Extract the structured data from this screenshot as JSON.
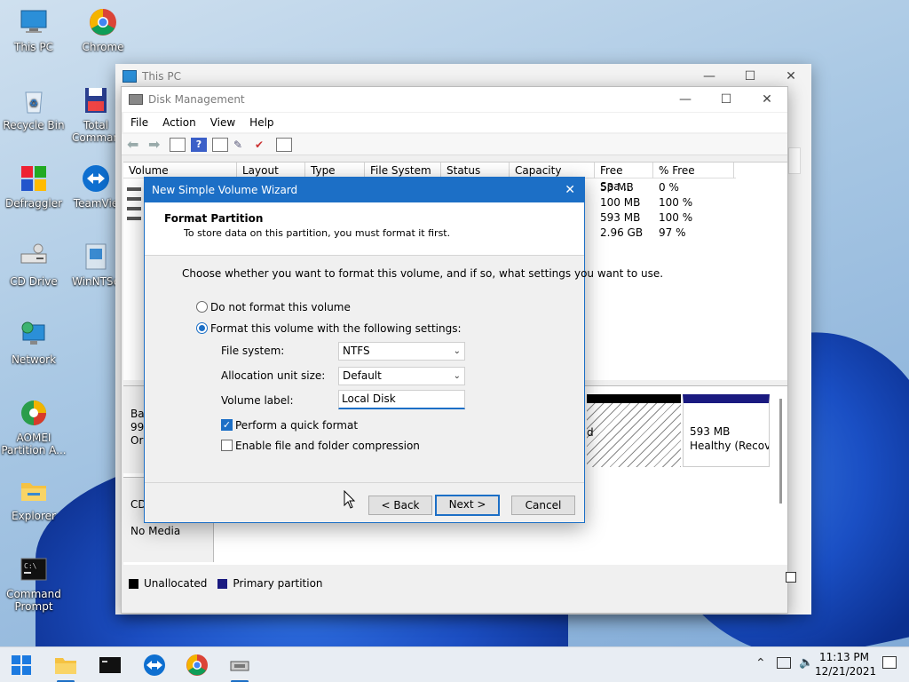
{
  "desktop": {
    "icons": [
      {
        "label": "This PC"
      },
      {
        "label": "Chrome"
      },
      {
        "label": "Recycle Bin"
      },
      {
        "label": "Total Comman"
      },
      {
        "label": "Defraggler"
      },
      {
        "label": "TeamVie"
      },
      {
        "label": "CD Drive"
      },
      {
        "label": "WinNTSe"
      },
      {
        "label": "Network"
      },
      {
        "label": "AOMEI Partition A..."
      },
      {
        "label": "Explorer"
      },
      {
        "label": "Command Prompt"
      }
    ]
  },
  "this_pc_window": {
    "title": "This PC"
  },
  "disk_mgmt": {
    "title": "Disk Management",
    "menu": [
      "File",
      "Action",
      "View",
      "Help"
    ],
    "columns": [
      "Volume",
      "Layout",
      "Type",
      "File System",
      "Status",
      "Capacity",
      "Free Spa...",
      "% Free"
    ],
    "rows": [
      {
        "free": "53 MB",
        "pct": "0 %"
      },
      {
        "free": "100 MB",
        "pct": "100 %"
      },
      {
        "free": "593 MB",
        "pct": "100 %"
      },
      {
        "free": "2.96 GB",
        "pct": "97 %"
      }
    ],
    "disk0": {
      "label_short": "Ba",
      "size_short": "99.",
      "status_short": "Or"
    },
    "cd": {
      "label_short": "CD",
      "media": "No Media"
    },
    "partition_text_d": "d",
    "recovery": {
      "size": "593 MB",
      "status": "Healthy (Recove"
    },
    "legend": {
      "unallocated": "Unallocated",
      "primary": "Primary partition"
    }
  },
  "wizard": {
    "title": "New Simple Volume Wizard",
    "heading": "Format Partition",
    "subheading": "To store data on this partition, you must format it first.",
    "instruction": "Choose whether you want to format this volume, and if so, what settings you want to use.",
    "opt_no_format": "Do not format this volume",
    "opt_format": "Format this volume with the following settings:",
    "fs_label": "File system:",
    "fs_value": "NTFS",
    "alloc_label": "Allocation unit size:",
    "alloc_value": "Default",
    "vol_label": "Volume label:",
    "vol_value": "Local Disk",
    "quick_format": "Perform a quick format",
    "compression": "Enable file and folder compression",
    "back": "< Back",
    "next": "Next >",
    "cancel": "Cancel"
  },
  "taskbar": {
    "time": "11:13 PM",
    "date": "12/21/2021"
  },
  "colors": {
    "accent": "#1c6fc6",
    "primary_partition": "#1a1a80",
    "unallocated": "#000000"
  }
}
